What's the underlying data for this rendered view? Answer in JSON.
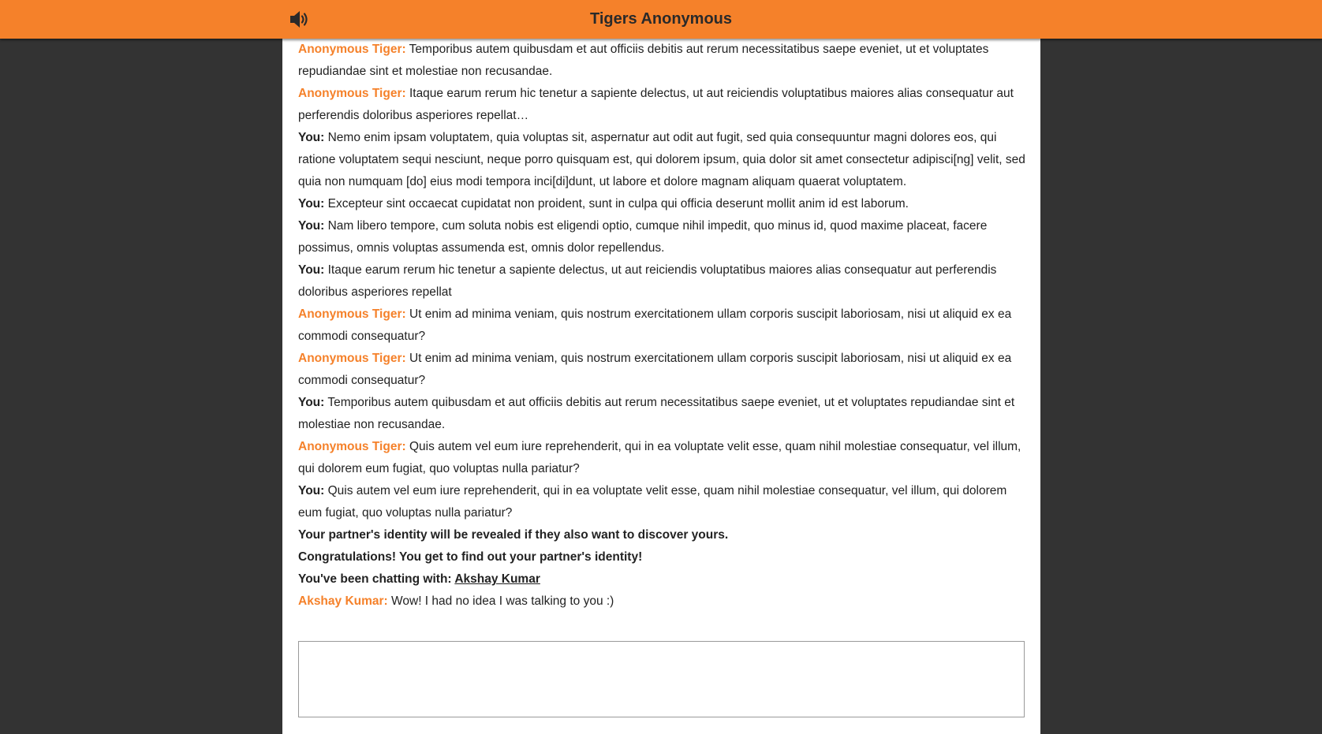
{
  "header": {
    "title": "Tigers Anonymous",
    "sound_icon": "speaker-volume-icon",
    "background_color": "#f5812a"
  },
  "messages": [
    {
      "kind": "other",
      "sender": "Anonymous Tiger:",
      "text": "Temporibus autem quibusdam et aut officiis debitis aut rerum necessitatibus saepe eveniet, ut et voluptates repudiandae sint et molestiae non recusandae."
    },
    {
      "kind": "other",
      "sender": "Anonymous Tiger:",
      "text": "Itaque earum rerum hic tenetur a sapiente delectus, ut aut reiciendis voluptatibus maiores alias consequatur aut perferendis doloribus asperiores repellat…"
    },
    {
      "kind": "you",
      "sender": "You:",
      "text": "Nemo enim ipsam voluptatem, quia voluptas sit, aspernatur aut odit aut fugit, sed quia consequuntur magni dolores eos, qui ratione voluptatem sequi nesciunt, neque porro quisquam est, qui dolorem ipsum, quia dolor sit amet consectetur adipisci[ng] velit, sed quia non numquam [do] eius modi tempora inci[di]dunt, ut labore et dolore magnam aliquam quaerat voluptatem."
    },
    {
      "kind": "you",
      "sender": "You:",
      "text": "Excepteur sint occaecat cupidatat non proident, sunt in culpa qui officia deserunt mollit anim id est laborum."
    },
    {
      "kind": "you",
      "sender": "You:",
      "text": "Nam libero tempore, cum soluta nobis est eligendi optio, cumque nihil impedit, quo minus id, quod maxime placeat, facere possimus, omnis voluptas assumenda est, omnis dolor repellendus."
    },
    {
      "kind": "you",
      "sender": "You:",
      "text": "Itaque earum rerum hic tenetur a sapiente delectus, ut aut reiciendis voluptatibus maiores alias consequatur aut perferendis doloribus asperiores repellat"
    },
    {
      "kind": "other",
      "sender": "Anonymous Tiger:",
      "text": "Ut enim ad minima veniam, quis nostrum exercitationem ullam corporis suscipit laboriosam, nisi ut aliquid ex ea commodi consequatur?"
    },
    {
      "kind": "other",
      "sender": "Anonymous Tiger:",
      "text": "Ut enim ad minima veniam, quis nostrum exercitationem ullam corporis suscipit laboriosam, nisi ut aliquid ex ea commodi consequatur?"
    },
    {
      "kind": "you",
      "sender": "You:",
      "text": "Temporibus autem quibusdam et aut officiis debitis aut rerum necessitatibus saepe eveniet, ut et voluptates repudiandae sint et molestiae non recusandae."
    },
    {
      "kind": "other",
      "sender": "Anonymous Tiger:",
      "text": "Quis autem vel eum iure reprehenderit, qui in ea voluptate velit esse, quam nihil molestiae consequatur, vel illum, qui dolorem eum fugiat, quo voluptas nulla pariatur?"
    },
    {
      "kind": "you",
      "sender": "You:",
      "text": "Quis autem vel eum iure reprehenderit, qui in ea voluptate velit esse, quam nihil molestiae consequatur, vel illum, qui dolorem eum fugiat, quo voluptas nulla pariatur?"
    }
  ],
  "system": {
    "partner_reveal_notice": "Your partner's identity will be revealed if they also want to discover yours.",
    "congratulations": "Congratulations! You get to find out your partner's identity!",
    "chatting_with_label": "You've been chatting with: ",
    "partner_name": "Akshay Kumar"
  },
  "final_message": {
    "sender": "Akshay Kumar:",
    "text": "Wow! I had no idea I was talking to you :)"
  },
  "composer": {
    "value": "",
    "placeholder": ""
  }
}
